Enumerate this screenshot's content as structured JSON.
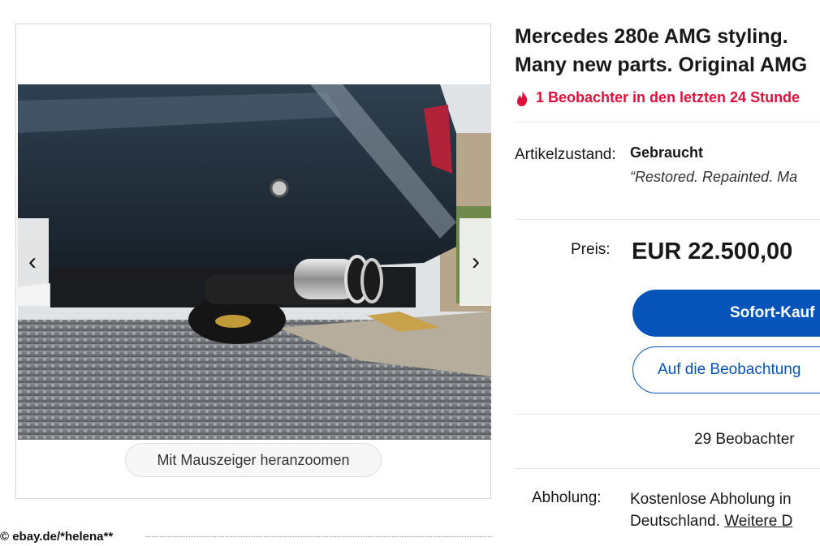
{
  "gallery": {
    "zoom_hint": "Mit Mauszeiger heranzoomen",
    "prev_icon": "chevron-left-icon",
    "next_icon": "chevron-right-icon",
    "prev_glyph": "‹",
    "next_glyph": "›"
  },
  "credit": "© ebay.de/*helena**",
  "listing": {
    "title_line1": "Mercedes 280e AMG styling.",
    "title_line2": "Many new parts. Original AMG",
    "watch_alert": "1 Beobachter in den letzten 24 Stunde",
    "condition_label": "Artikelzustand:",
    "condition_value": "Gebraucht",
    "condition_quote": "“Restored. Repainted. Ma",
    "price_label": "Preis:",
    "price_value": "EUR 22.500,00",
    "buy_button": "Sofort-Kauf",
    "watch_button": "Auf die Beobachtung",
    "watchers": "29 Beobachter",
    "pickup_label": "Abholung:",
    "pickup_line1": "Kostenlose Abholung in",
    "pickup_line2_text": "Deutschland.",
    "pickup_link": "Weitere D"
  },
  "colors": {
    "accent_blue": "#0654ba",
    "alert_red": "#e0103a"
  }
}
